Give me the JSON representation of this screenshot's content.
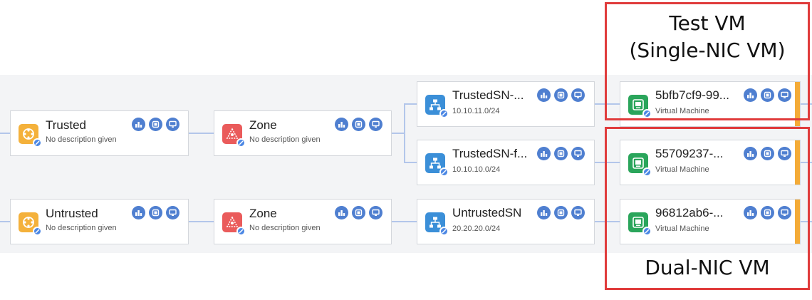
{
  "nodes": {
    "trusted_policy": {
      "title": "Trusted",
      "subtitle": "No description given",
      "icon": "policy-icon"
    },
    "zone_top": {
      "title": "Zone",
      "subtitle": "No description given",
      "icon": "zone-icon"
    },
    "trusted_subnet_1": {
      "title": "TrustedSN-...",
      "subtitle": "10.10.11.0/24",
      "icon": "subnet-icon"
    },
    "trusted_subnet_2": {
      "title": "TrustedSN-f...",
      "subtitle": "10.10.10.0/24",
      "icon": "subnet-icon"
    },
    "vm_1": {
      "title": "5bfb7cf9-99...",
      "subtitle": "Virtual Machine",
      "icon": "vm-icon"
    },
    "vm_2": {
      "title": "55709237-...",
      "subtitle": "Virtual Machine",
      "icon": "vm-icon"
    },
    "untrusted_policy": {
      "title": "Untrusted",
      "subtitle": "No description given",
      "icon": "policy-icon"
    },
    "zone_bottom": {
      "title": "Zone",
      "subtitle": "No description given",
      "icon": "zone-icon"
    },
    "untrusted_subnet": {
      "title": "UntrustedSN",
      "subtitle": "20.20.20.0/24",
      "icon": "subnet-icon"
    },
    "vm_3": {
      "title": "96812ab6-...",
      "subtitle": "Virtual Machine",
      "icon": "vm-icon"
    }
  },
  "callouts": {
    "test_vm": {
      "line1": "Test VM",
      "line2": "(Single-NIC VM)"
    },
    "dual_nic_vm": {
      "line1": "Dual-NIC VM"
    }
  },
  "colors": {
    "band": "#f3f4f6",
    "wire": "#b3c6ea",
    "callout_border": "#e03c3c",
    "vm_accent": "#f4ab37",
    "action_button": "#4f7fd0"
  }
}
